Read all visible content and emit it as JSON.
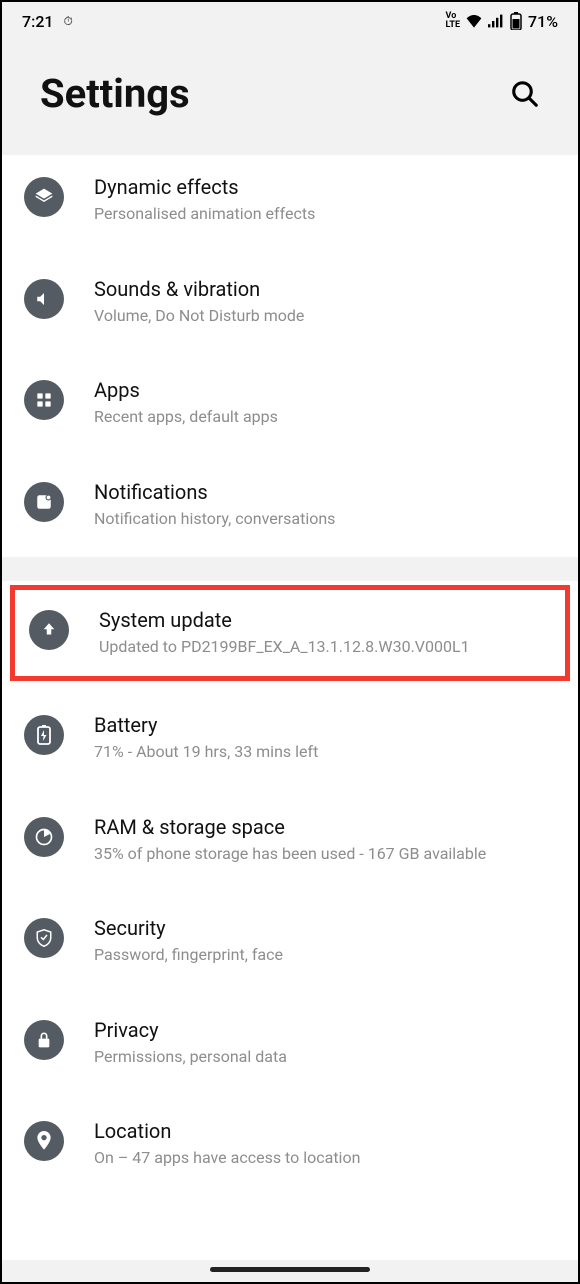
{
  "status": {
    "time": "7:21",
    "lte": "VoLTE",
    "battery_pct": "71%"
  },
  "header": {
    "title": "Settings"
  },
  "items": [
    {
      "title": "Dynamic effects",
      "sub": "Personalised animation effects"
    },
    {
      "title": "Sounds & vibration",
      "sub": "Volume, Do Not Disturb mode"
    },
    {
      "title": "Apps",
      "sub": "Recent apps, default apps"
    },
    {
      "title": "Notifications",
      "sub": "Notification history, conversations"
    },
    {
      "title": "System update",
      "sub": "Updated to PD2199BF_EX_A_13.1.12.8.W30.V000L1"
    },
    {
      "title": "Battery",
      "sub": "71% - About 19 hrs, 33 mins left"
    },
    {
      "title": "RAM & storage space",
      "sub": "35% of phone storage has been used - 167 GB available"
    },
    {
      "title": "Security",
      "sub": "Password, fingerprint, face"
    },
    {
      "title": "Privacy",
      "sub": "Permissions, personal data"
    },
    {
      "title": "Location",
      "sub": "On – 47 apps have access to location"
    }
  ]
}
